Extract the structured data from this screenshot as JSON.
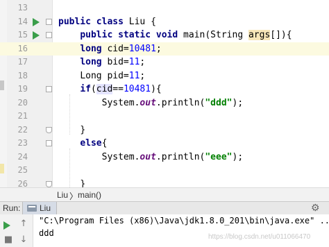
{
  "editor": {
    "lines": [
      {
        "no": "13",
        "text": ""
      },
      {
        "no": "14",
        "text": "public class Liu {"
      },
      {
        "no": "15",
        "text": "    public static void main(String args[]){"
      },
      {
        "no": "16",
        "text": "    long cid=10481;"
      },
      {
        "no": "17",
        "text": "    long bid=11;"
      },
      {
        "no": "18",
        "text": "    Long pid=11;"
      },
      {
        "no": "19",
        "text": "    if(cid==10481){"
      },
      {
        "no": "20",
        "text": "        System.out.println(\"ddd\");"
      },
      {
        "no": "21",
        "text": ""
      },
      {
        "no": "22",
        "text": "    }"
      },
      {
        "no": "23",
        "text": "    else{"
      },
      {
        "no": "24",
        "text": "        System.out.println(\"eee\");"
      },
      {
        "no": "25",
        "text": ""
      },
      {
        "no": "26",
        "text": "    }"
      }
    ],
    "current_line": "16"
  },
  "code_tokens": {
    "l14": [
      "public",
      "class",
      "Liu {"
    ],
    "l15": [
      "public",
      "static",
      "void",
      "main(String ",
      "args",
      "[]){"
    ],
    "l16": [
      "long",
      "cid=",
      "10481",
      ";"
    ],
    "l17": [
      "long",
      "bid=",
      "11",
      ";"
    ],
    "l18": [
      "Long pid=",
      "11",
      ";"
    ],
    "l19": [
      "if",
      "(",
      "cid",
      "==",
      "10481",
      "){"
    ],
    "l20": [
      "System.",
      "out",
      ".println(",
      "\"ddd\"",
      ");"
    ],
    "l22": [
      "}"
    ],
    "l23": [
      "else",
      "{"
    ],
    "l24": [
      "System.",
      "out",
      ".println(",
      "\"eee\"",
      ");"
    ],
    "l26": [
      "}"
    ]
  },
  "breadcrumb": {
    "class": "Liu",
    "separator": "〉",
    "method": "main()"
  },
  "run_panel": {
    "label": "Run:",
    "tab": "Liu",
    "command": "\"C:\\Program Files (x86)\\Java\\jdk1.8.0_201\\bin\\java.exe\" ...",
    "output": "ddd",
    "toolbar_icons": [
      "play-icon",
      "arrow-up-icon",
      "stop-icon",
      "arrow-down-icon"
    ]
  },
  "watermark": "https://blog.csdn.net/u011066470",
  "colors": {
    "keyword": "#000080",
    "number": "#0000ff",
    "string": "#008000",
    "field": "#660e7a",
    "run_green": "#3a9e4a",
    "current_line": "#fcfae0"
  }
}
